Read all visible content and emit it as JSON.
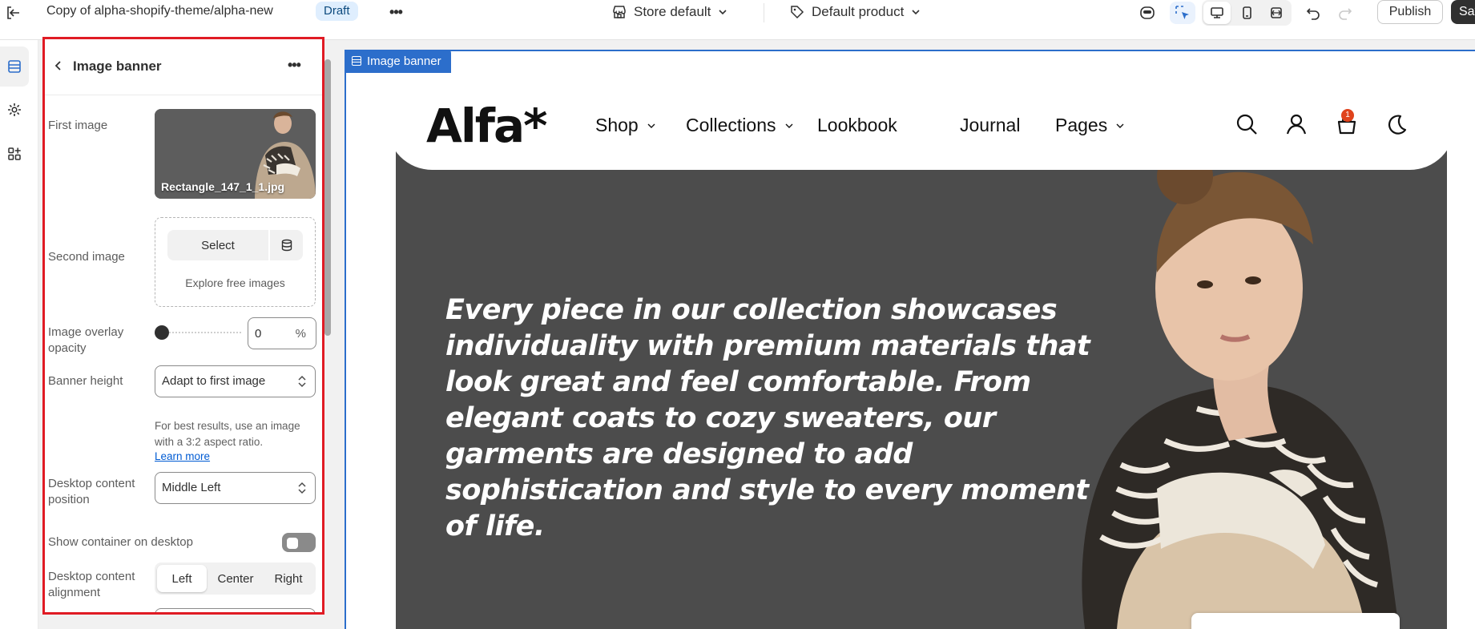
{
  "topbar": {
    "theme_title": "Copy of alpha-shopify-theme/alpha-new",
    "status_badge": "Draft",
    "more_label": "•••",
    "store_select": "Store default",
    "product_select": "Default product",
    "publish_label": "Publish",
    "save_label": "Save"
  },
  "panel": {
    "title": "Image banner",
    "more_label": "•••",
    "first_image": {
      "label": "First image",
      "filename": "Rectangle_147_1_1.jpg"
    },
    "second_image": {
      "label": "Second image",
      "select_label": "Select",
      "explore_label": "Explore free images"
    },
    "overlay_opacity": {
      "label": "Image overlay opacity",
      "value": "0",
      "unit": "%",
      "slider_fraction": 0
    },
    "banner_height": {
      "label": "Banner height",
      "value": "Adapt to first image",
      "help": "For best results, use an image with a 3:2 aspect ratio.",
      "learn_more": "Learn more"
    },
    "desktop_position": {
      "label": "Desktop content position",
      "value": "Middle Left"
    },
    "show_container": {
      "label": "Show container on desktop",
      "enabled": false
    },
    "desktop_alignment": {
      "label": "Desktop content alignment",
      "options": [
        "Left",
        "Center",
        "Right"
      ],
      "selected": "Left"
    }
  },
  "preview": {
    "section_tag": "Image banner",
    "logo": "Alfa*",
    "nav": [
      "Shop",
      "Collections",
      "Lookbook",
      "Journal",
      "Pages"
    ],
    "cart_count": "1",
    "banner_text": "Every piece in our collection showcases individuality with premium materials that look great and feel comfortable. From elegant coats to cozy sweaters, our garments are designed to add sophistication and style to every moment of life."
  },
  "colors": {
    "highlight_box": "#e01b24",
    "section_accent": "#2c6ecb",
    "banner_bg": "#4c4c4c",
    "cart_badge": "#e0431c"
  }
}
